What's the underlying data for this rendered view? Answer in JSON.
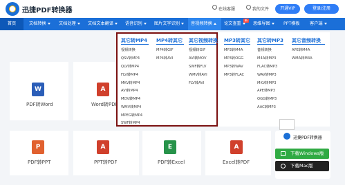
{
  "header": {
    "brand": "迅捷PDF转换器",
    "links": [
      "在线客服",
      "我的文件"
    ],
    "vip_label": "开通VIP",
    "login_label": "登录/注册"
  },
  "nav": {
    "items": [
      {
        "label": "首页"
      },
      {
        "label": "文档转换"
      },
      {
        "label": "文档处理"
      },
      {
        "label": "文档文本翻译"
      },
      {
        "label": "语音识别"
      },
      {
        "label": "图片文字识别"
      },
      {
        "label": "音视频转换"
      },
      {
        "label": "论文查重"
      },
      {
        "label": "思维导图"
      },
      {
        "label": "PPT模板"
      },
      {
        "label": "客户端"
      }
    ],
    "badge": "新"
  },
  "dropdown": {
    "columns": [
      {
        "title": "其它转MP4",
        "items": [
          "视频转换",
          "QSV转MP4",
          "QLV转MP4",
          "FLV转MP4",
          "MKV转MP4",
          "AVI转MP4",
          "MOV转MP4",
          "WMV转MP4",
          "MPEG转MP4",
          "SWF转MP4"
        ]
      },
      {
        "title": "MP4转其它",
        "items": [
          "MP4转GIF",
          "MP4转AVI"
        ]
      },
      {
        "title": "其它视频转换",
        "items": [
          "视频转GIF",
          "AVI转MOV",
          "SWF转FLV",
          "WMV转AVI",
          "FLV转AVI"
        ]
      },
      {
        "title": "MP3转其它",
        "items": [
          "MP3转M4A",
          "MP3转OGG",
          "MP3转WAV",
          "MP3转FLAC"
        ]
      },
      {
        "title": "其它转MP3",
        "items": [
          "音频转换",
          "M4A转MP3",
          "FLAC转MP3",
          "WAV转MP3",
          "MKV转MP3",
          "APE转MP3",
          "OGG转MP3",
          "AAC转MP3"
        ]
      },
      {
        "title": "其它音频转换",
        "items": [
          "APE转M4A",
          "WMA转M4A"
        ]
      }
    ]
  },
  "tiles": [
    {
      "icon": "W",
      "label": "PDF转Word",
      "color": "#2b5eb8"
    },
    {
      "icon": "A",
      "label": "Word转PDF",
      "color": "#d0402c"
    },
    {
      "icon": "P",
      "label": "PDF转PPT",
      "color": "#e1612f"
    },
    {
      "icon": "A",
      "label": "PPT转PDF",
      "color": "#d0402c"
    },
    {
      "icon": "E",
      "label": "PDF转Excel",
      "color": "#27934a"
    },
    {
      "icon": "A",
      "label": "Excel转PDF",
      "color": "#d0402c"
    }
  ],
  "promo": {
    "title": "迅捷PDF转换器",
    "windows_label": "下载Windows版",
    "mac_label": "下载Mac版"
  }
}
